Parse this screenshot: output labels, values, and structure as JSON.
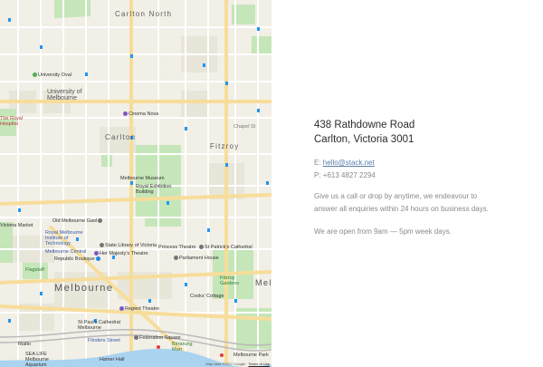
{
  "map": {
    "areas": {
      "carlton_north": "Carlton North",
      "carlton": "Carlton",
      "fitzroy": "Fitzroy",
      "melbourne": "Melbourne",
      "melb_edge": "Mel"
    },
    "pois": {
      "university_oval": "University Oval",
      "university": "University of\nMelbourne",
      "royal_hospital": "The Royal\nHospital",
      "cinema_nova": "Cinema Nova",
      "museum": "Melbourne Museum",
      "royal_exhibition": "Royal Exhibition\nBuilding",
      "old_gaol": "Old Melbourne Gaol",
      "victoria_market": "Victoria Market",
      "rmit": "Royal Melbourne\nInstitute of\nTechnology",
      "melbourne_central": "Melbourne Central",
      "state_library": "State Library of Victoria",
      "her_majestys": "Her Majesty's Theatre",
      "republic_boutique": "Republic Boutique",
      "princess_theatre": "Princess Theatre",
      "st_patricks": "St Patrick's Cathedral",
      "parliament": "Parliament House",
      "flagstaff": "Flagstaff",
      "fitzroy_gardens": "Fitzroy\nGardens",
      "cooks_cottage": "Cooks' Cottage",
      "regent_theatre": "Regent Theatre",
      "st_pauls": "St Paul's Cathedral\nMelbourne",
      "federation_square": "Federation Square",
      "flinders_street": "Flinders Street",
      "birrarung": "Birrarung\nMarr",
      "rialto": "Rialto",
      "sea_life": "SEA LIFE\nMelbourne\nAquarium",
      "hamer_hall": "Hamer Hall",
      "melbourne_park": "Melbourne Park",
      "chapel_st": "Chapel St"
    },
    "attribution": "Map data ©2017 Google",
    "terms": "Terms of Use",
    "colors": {
      "land": "#f1efe6",
      "park": "#c5e6b8",
      "road": "#ffffff",
      "major_road": "#f7dd9a",
      "water": "#a9d3ef",
      "block": "#e7e4d8",
      "transit": "#2196f3"
    }
  },
  "contact": {
    "address_line1": "438 Rathdowne Road",
    "address_line2": "Carlton, Victoria 3001",
    "email_prefix": "E: ",
    "email": "hello@stack.net",
    "phone": "P: +613 4827 2294",
    "message": "Give us a call or drop by anytime, we endeavour to answer all enquiries within 24 hours on business days.",
    "hours": "We are open from 9am — 5pm week days."
  }
}
